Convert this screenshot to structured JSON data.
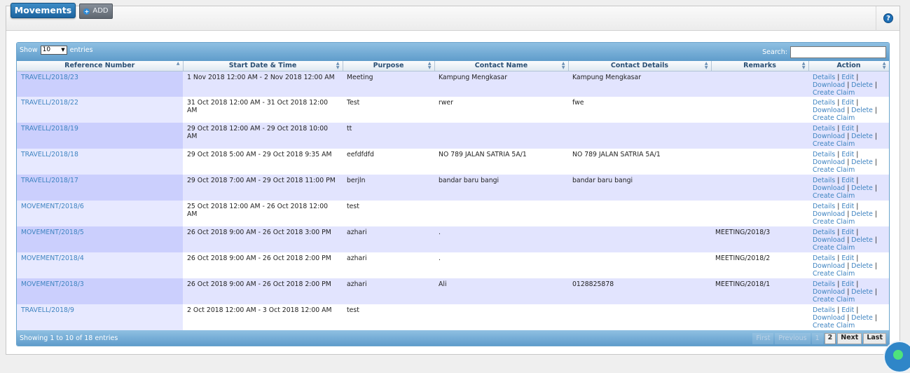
{
  "header": {
    "tab_label": "Movements",
    "add_label": "ADD",
    "help_label": "?"
  },
  "table_controls": {
    "show_label": "Show",
    "entries_value": "10",
    "entries_label": "entries",
    "search_label": "Search:",
    "search_value": ""
  },
  "columns": [
    "Reference Number",
    "Start Date & Time",
    "Purpose",
    "Contact Name",
    "Contact Details",
    "Remarks",
    "Action"
  ],
  "rows": [
    {
      "ref": "TRAVELL/2018/23",
      "date": "1 Nov 2018 12:00 AM - 2 Nov 2018 12:00 AM",
      "purpose": "Meeting",
      "contact_name": "Kampung Mengkasar",
      "contact_details": "Kampung Mengkasar",
      "remarks": ""
    },
    {
      "ref": "TRAVELL/2018/22",
      "date": "31 Oct 2018 12:00 AM - 31 Oct 2018 12:00 AM",
      "purpose": "Test",
      "contact_name": "rwer",
      "contact_details": "fwe",
      "remarks": ""
    },
    {
      "ref": "TRAVELL/2018/19",
      "date": "29 Oct 2018 12:00 AM - 29 Oct 2018 10:00 AM",
      "purpose": "tt",
      "contact_name": "",
      "contact_details": "",
      "remarks": ""
    },
    {
      "ref": "TRAVELL/2018/18",
      "date": "29 Oct 2018 5:00 AM - 29 Oct 2018 9:35 AM",
      "purpose": "eefdfdfd",
      "contact_name": "NO 789 JALAN SATRIA 5A/1",
      "contact_details": "NO 789 JALAN SATRIA 5A/1",
      "remarks": ""
    },
    {
      "ref": "TRAVELL/2018/17",
      "date": "29 Oct 2018 7:00 AM - 29 Oct 2018 11:00 PM",
      "purpose": "berjln",
      "contact_name": "bandar baru bangi",
      "contact_details": "bandar baru bangi",
      "remarks": ""
    },
    {
      "ref": "MOVEMENT/2018/6",
      "date": "25 Oct 2018 12:00 AM - 26 Oct 2018 12:00 AM",
      "purpose": "test",
      "contact_name": "",
      "contact_details": "",
      "remarks": ""
    },
    {
      "ref": "MOVEMENT/2018/5",
      "date": "26 Oct 2018 9:00 AM - 26 Oct 2018 3:00 PM",
      "purpose": "azhari",
      "contact_name": ".",
      "contact_details": "",
      "remarks": "MEETING/2018/3"
    },
    {
      "ref": "MOVEMENT/2018/4",
      "date": "26 Oct 2018 9:00 AM - 26 Oct 2018 2:00 PM",
      "purpose": "azhari",
      "contact_name": ".",
      "contact_details": "",
      "remarks": "MEETING/2018/2"
    },
    {
      "ref": "MOVEMENT/2018/3",
      "date": "26 Oct 2018 9:00 AM - 26 Oct 2018 2:00 PM",
      "purpose": "azhari",
      "contact_name": "Ali",
      "contact_details": "0128825878",
      "remarks": "MEETING/2018/1"
    },
    {
      "ref": "TRAVELL/2018/9",
      "date": "2 Oct 2018 12:00 AM - 3 Oct 2018 12:00 AM",
      "purpose": "test",
      "contact_name": "",
      "contact_details": "",
      "remarks": ""
    }
  ],
  "actions": {
    "details": "Details",
    "edit": "Edit",
    "download": "Download",
    "delete": "Delete",
    "create_claim": "Create Claim",
    "sep": "|"
  },
  "footer": {
    "showing_text": "Showing 1 to 10 of 18 entries",
    "pager": {
      "first": "First",
      "previous": "Previous",
      "page1": "1",
      "page2": "2",
      "next": "Next",
      "last": "Last"
    }
  },
  "colors": {
    "tab_blue": "#1d64a0",
    "table_header_blue": "#5f9ccb",
    "link_blue": "#3f84c1",
    "row_odd": "#e2e4fe"
  }
}
